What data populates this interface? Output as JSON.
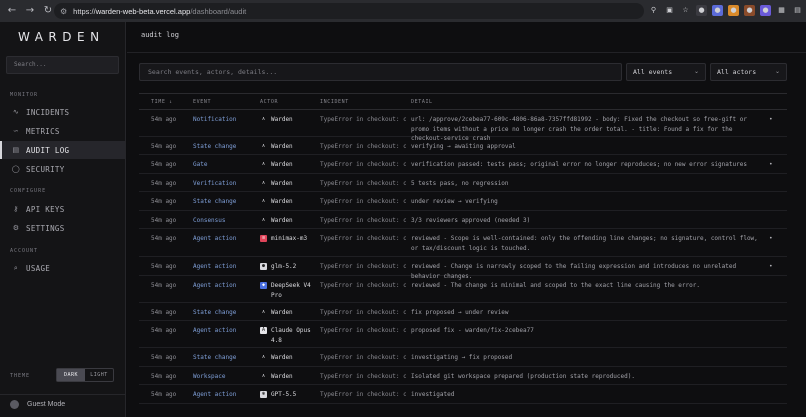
{
  "browser": {
    "url_host": "warden-web-beta.vercel.app",
    "url_path": "/dashboard/audit"
  },
  "sidebar": {
    "logo": "WARDEN",
    "search_placeholder": "Search...",
    "sections": {
      "monitor": "MONITOR",
      "configure": "CONFIGURE",
      "account": "ACCOUNT"
    },
    "items": [
      {
        "label": "INCIDENTS",
        "icon": "activity-icon"
      },
      {
        "label": "METRICS",
        "icon": "chart-icon"
      },
      {
        "label": "AUDIT LOG",
        "icon": "document-icon"
      },
      {
        "label": "SECURITY",
        "icon": "shield-icon"
      },
      {
        "label": "API KEYS",
        "icon": "key-icon"
      },
      {
        "label": "SETTINGS",
        "icon": "gear-icon"
      },
      {
        "label": "USAGE",
        "icon": "gauge-icon"
      }
    ],
    "theme_label": "THEME",
    "theme_dark": "DARK",
    "theme_light": "LIGHT",
    "guest_label": "Guest Mode"
  },
  "main": {
    "title": "audit log",
    "search_placeholder": "Search events, actors, details...",
    "filter_events": "All events",
    "filter_actors": "All actors",
    "columns": {
      "time": "TIME ↓",
      "event": "EVENT",
      "actor": "ACTOR",
      "incident": "INCIDENT",
      "detail": "DETAIL"
    },
    "rows": [
      {
        "time": "54m ago",
        "event": "Notification",
        "actor": "Warden",
        "incident": "TypeError in checkout: ca...",
        "detail": "url: /approve/2cebea77-609c-4806-86a8-7357ffd81992 - body: Fixed the checkout so free-gift or promo items without a price no longer crash the order total. - title: Found a fix for the checkout-service crash",
        "dot": "•"
      },
      {
        "time": "54m ago",
        "event": "State change",
        "actor": "Warden",
        "incident": "TypeError in checkout: ca...",
        "detail": "verifying → awaiting approval",
        "dot": ""
      },
      {
        "time": "54m ago",
        "event": "Gate",
        "actor": "Warden",
        "incident": "TypeError in checkout: ca...",
        "detail": "verification passed: tests pass; original error no longer reproduces; no new error signatures",
        "dot": "•"
      },
      {
        "time": "54m ago",
        "event": "Verification",
        "actor": "Warden",
        "incident": "TypeError in checkout: ca...",
        "detail": "5 tests pass, no regression",
        "dot": ""
      },
      {
        "time": "54m ago",
        "event": "State change",
        "actor": "Warden",
        "incident": "TypeError in checkout: ca...",
        "detail": "under review → verifying",
        "dot": ""
      },
      {
        "time": "54m ago",
        "event": "Consensus",
        "actor": "Warden",
        "incident": "TypeError in checkout: ca...",
        "detail": "3/3 reviewers approved (needed 3)",
        "dot": ""
      },
      {
        "time": "54m ago",
        "event": "Agent action",
        "actor": "minimax-m3",
        "incident": "TypeError in checkout: ca...",
        "detail": "reviewed - Scope is well-contained: only the offending line changes; no signature, control flow, or tax/discount logic is touched.",
        "dot": "•"
      },
      {
        "time": "54m ago",
        "event": "Agent action",
        "actor": "glm-5.2",
        "incident": "TypeError in checkout: ca...",
        "detail": "reviewed - Change is narrowly scoped to the failing expression and introduces no unrelated behavior changes.",
        "dot": "•"
      },
      {
        "time": "54m ago",
        "event": "Agent action",
        "actor": "DeepSeek V4 Pro",
        "incident": "TypeError in checkout: ca...",
        "detail": "reviewed - The change is minimal and scoped to the exact line causing the error.",
        "dot": ""
      },
      {
        "time": "54m ago",
        "event": "State change",
        "actor": "Warden",
        "incident": "TypeError in checkout: ca...",
        "detail": "fix proposed → under review",
        "dot": ""
      },
      {
        "time": "54m ago",
        "event": "Agent action",
        "actor": "Claude Opus 4.8",
        "incident": "TypeError in checkout: ca...",
        "detail": "proposed fix - warden/fix-2cebea77",
        "dot": ""
      },
      {
        "time": "54m ago",
        "event": "State change",
        "actor": "Warden",
        "incident": "TypeError in checkout: ca...",
        "detail": "investigating → fix proposed",
        "dot": ""
      },
      {
        "time": "54m ago",
        "event": "Workspace",
        "actor": "Warden",
        "incident": "TypeError in checkout: ca...",
        "detail": "Isolated git workspace prepared (production state reproduced).",
        "dot": ""
      },
      {
        "time": "54m ago",
        "event": "Agent action",
        "actor": "GPT-5.5",
        "incident": "TypeError in checkout: ca...",
        "detail": "investigated",
        "dot": ""
      }
    ]
  }
}
